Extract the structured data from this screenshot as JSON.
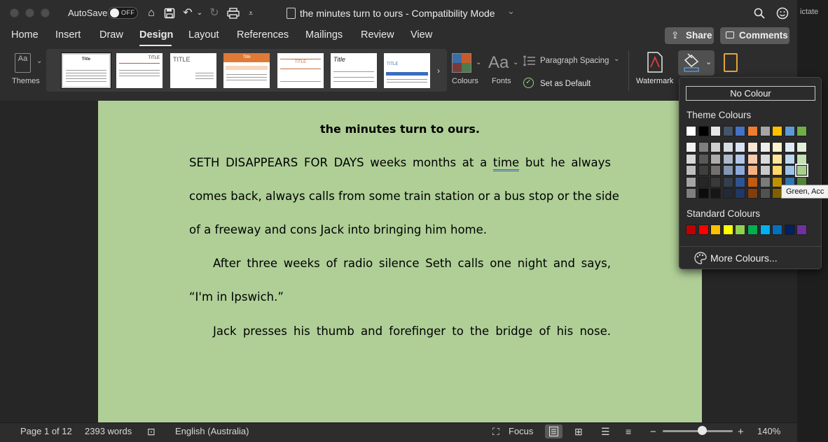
{
  "titlebar": {
    "autosave_label": "AutoSave",
    "autosave_state": "OFF",
    "document_title": "the minutes turn to ours  -  Compatibility Mode"
  },
  "menu": {
    "tabs": [
      "Home",
      "Insert",
      "Draw",
      "Design",
      "Layout",
      "References",
      "Mailings",
      "Review",
      "View"
    ],
    "active_tab": "Design",
    "share": "Share",
    "comments": "Comments"
  },
  "ribbon": {
    "themes": "Themes",
    "colours": "Colours",
    "fonts": "Fonts",
    "paragraph_spacing": "Paragraph Spacing",
    "set_as_default": "Set as Default",
    "watermark": "Watermark",
    "thumb_titles": [
      "Title",
      "TITLE",
      "TITLE",
      "Title",
      "TITLE",
      "Title",
      "TITLE"
    ]
  },
  "document": {
    "heading": "the minutes turn to ours.",
    "lines": [
      [
        "SETH DISAPPEARS FOR DAYS weeks months at a ",
        "time",
        " but he always"
      ],
      "comes back, always calls from some train station or a bus stop or the side",
      "of a freeway and cons Jack into bringing him home.",
      "After three weeks of radio silence Seth calls one night and says,",
      "“I'm in Ipswich.”",
      "Jack presses his thumb and forefinger to the bridge of his nose."
    ],
    "page_colour": "#afcf97"
  },
  "colour_menu": {
    "no_colour": "No Colour",
    "theme_title": "Theme Colours",
    "standard_title": "Standard Colours",
    "more": "More Colours...",
    "tooltip": "Green, Acc",
    "theme_row": [
      "#ffffff",
      "#000000",
      "#e7e6e6",
      "#44546a",
      "#4472c4",
      "#ed7d31",
      "#a5a5a5",
      "#ffc000",
      "#5b9bd5",
      "#70ad47"
    ],
    "theme_shades": [
      [
        "#f2f2f2",
        "#7f7f7f",
        "#d0cece",
        "#d6dce4",
        "#d9e2f3",
        "#fbe5d5",
        "#ededed",
        "#fff2cc",
        "#deebf6",
        "#e2efd9"
      ],
      [
        "#d8d8d8",
        "#595959",
        "#aeabab",
        "#adb9ca",
        "#b4c6e7",
        "#f7cbac",
        "#dbdbdb",
        "#fee599",
        "#bdd7ee",
        "#c5e0b3"
      ],
      [
        "#bfbfbf",
        "#3f3f3f",
        "#757070",
        "#8496b0",
        "#8eaadb",
        "#f4b183",
        "#c9c9c9",
        "#ffd965",
        "#9cc3e5",
        "#a8d08d"
      ],
      [
        "#a5a5a5",
        "#262626",
        "#3a3838",
        "#323f4f",
        "#2f5496",
        "#c55a11",
        "#7b7b7b",
        "#bf9000",
        "#2e75b5",
        "#538135"
      ],
      [
        "#7f7f7f",
        "#0c0c0c",
        "#171616",
        "#222a35",
        "#1f3864",
        "#833c0b",
        "#525252",
        "#7f6000",
        "#1e4e79",
        "#375623"
      ]
    ],
    "standard_row": [
      "#c00000",
      "#ff0000",
      "#ffc000",
      "#ffff00",
      "#92d050",
      "#00b050",
      "#00b0f0",
      "#0070c0",
      "#002060",
      "#7030a0"
    ],
    "hover_index": [
      2,
      9
    ]
  },
  "status": {
    "page": "Page 1 of 12",
    "words": "2393 words",
    "language": "English (Australia)",
    "focus": "Focus",
    "zoom": "140%",
    "zoom_fraction": 0.56
  },
  "edge": {
    "text": "ictate"
  }
}
